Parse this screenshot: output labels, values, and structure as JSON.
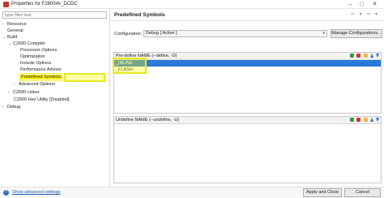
{
  "window": {
    "title": "Properties for F28004x_DCDC",
    "controls": [
      "–",
      "□",
      "✕"
    ]
  },
  "sidebar": {
    "filter_placeholder": "type filter text",
    "items": [
      {
        "label": "Resource",
        "arrow": "›"
      },
      {
        "label": "General",
        "arrow": ""
      },
      {
        "label": "Build",
        "arrow": "⌄"
      },
      {
        "label": "C2000 Compiler",
        "arrow": "⌄"
      },
      {
        "label": "Processor Options",
        "arrow": ""
      },
      {
        "label": "Optimization",
        "arrow": ""
      },
      {
        "label": "Include Options",
        "arrow": ""
      },
      {
        "label": "Performance Advisor",
        "arrow": ""
      },
      {
        "label": "Predefined Symbols",
        "arrow": ""
      },
      {
        "label": "Advanced Options",
        "arrow": "›"
      },
      {
        "label": "C2000 Linker",
        "arrow": "›"
      },
      {
        "label": "C2000 Hex Utility  [Disabled]",
        "arrow": ""
      },
      {
        "label": "Debug",
        "arrow": "›"
      }
    ]
  },
  "main": {
    "page_title": "Predefined Symbols",
    "nav_arrows": "⇦ ▾ ⇨ ▾",
    "configuration_label": "Configuration:",
    "configuration_value": "Debug  [ Active ]",
    "manage_button": "Manage Configurations...",
    "predefine_panel": {
      "title": "Pre-define NAME (--define, -D)",
      "symbols": [
        "_INLINE",
        "_FLASH"
      ]
    },
    "undefine_panel": {
      "title": "Undefine NAME (--undefine, -U)",
      "symbols": []
    }
  },
  "footer": {
    "help": "?",
    "advanced_link": "Show advanced settings",
    "apply_close_button": "Apply and Close",
    "cancel_button": "Cancel"
  },
  "colors": {
    "selection": "#2b79d8",
    "highlight": "#fff200",
    "link": "#1a5fb4"
  }
}
